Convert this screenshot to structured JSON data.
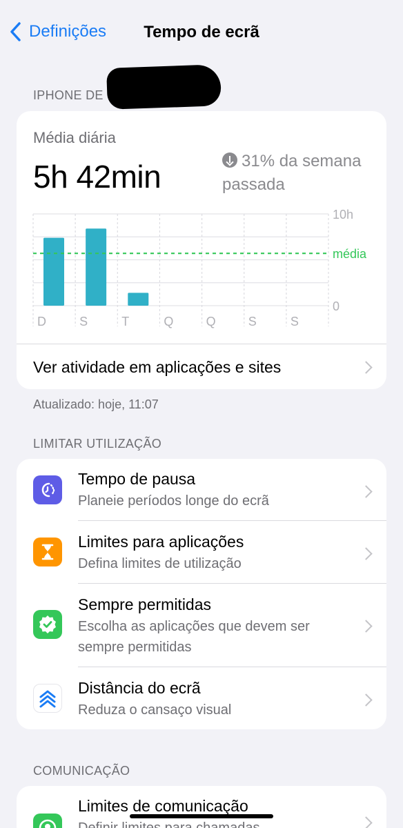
{
  "nav": {
    "back_label": "Definições",
    "title": "Tempo de ecrã"
  },
  "device_header": "IPHONE DE",
  "summary": {
    "avg_label": "Média diária",
    "avg_value": "5h 42min",
    "change_text": "31% da semana passada",
    "activity_link": "Ver atividade em aplicações e sites",
    "updated": "Atualizado: hoje, 11:07"
  },
  "chart_data": {
    "type": "bar",
    "categories": [
      "D",
      "S",
      "T",
      "Q",
      "Q",
      "S",
      "S"
    ],
    "values": [
      7.4,
      8.4,
      1.4,
      0,
      0,
      0,
      0
    ],
    "ylim": [
      0,
      10
    ],
    "y_tick_labels": [
      "10h",
      "0"
    ],
    "average_label": "média",
    "average_value": 5.7,
    "bar_color": "#30b0c7",
    "average_color": "#34c759"
  },
  "limit_header": "LIMITAR UTILIZAÇÃO",
  "limit_items": [
    {
      "title": "Tempo de pausa",
      "subtitle": "Planeie períodos longe do ecrã",
      "icon": "downtime-icon",
      "color": "#5e5ce6"
    },
    {
      "title": "Limites para aplicações",
      "subtitle": "Defina limites de utilização",
      "icon": "hourglass-icon",
      "color": "#ff9500"
    },
    {
      "title": "Sempre permitidas",
      "subtitle": "Escolha as aplicações que devem ser sempre permitidas",
      "icon": "checkmark-badge-icon",
      "color": "#34c759"
    },
    {
      "title": "Distância do ecrã",
      "subtitle": "Reduza o cansaço visual",
      "icon": "chevrons-up-icon",
      "color": "#1a7cf5"
    }
  ],
  "communication_header": "COMUNICAÇÃO",
  "communication_items": [
    {
      "title": "Limites de comunicação",
      "subtitle": "Definir limites para chamadas",
      "icon": "contact-icon",
      "color": "#34c759"
    }
  ]
}
